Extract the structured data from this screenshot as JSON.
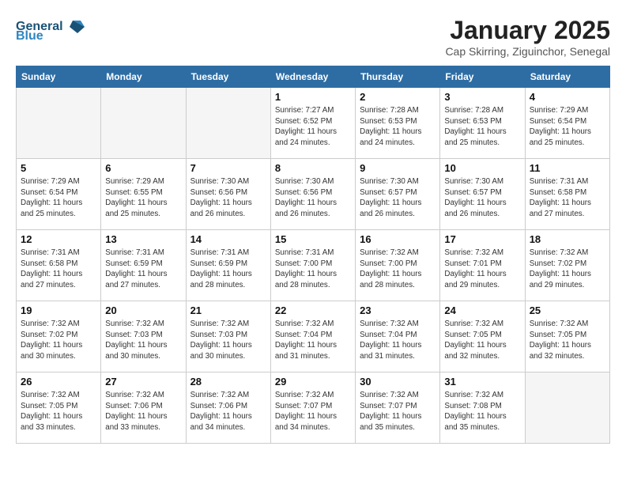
{
  "header": {
    "logo_line1": "General",
    "logo_line2": "Blue",
    "month": "January 2025",
    "location": "Cap Skirring, Ziguinchor, Senegal"
  },
  "days_of_week": [
    "Sunday",
    "Monday",
    "Tuesday",
    "Wednesday",
    "Thursday",
    "Friday",
    "Saturday"
  ],
  "weeks": [
    [
      {
        "day": "",
        "info": ""
      },
      {
        "day": "",
        "info": ""
      },
      {
        "day": "",
        "info": ""
      },
      {
        "day": "1",
        "info": "Sunrise: 7:27 AM\nSunset: 6:52 PM\nDaylight: 11 hours and 24 minutes."
      },
      {
        "day": "2",
        "info": "Sunrise: 7:28 AM\nSunset: 6:53 PM\nDaylight: 11 hours and 24 minutes."
      },
      {
        "day": "3",
        "info": "Sunrise: 7:28 AM\nSunset: 6:53 PM\nDaylight: 11 hours and 25 minutes."
      },
      {
        "day": "4",
        "info": "Sunrise: 7:29 AM\nSunset: 6:54 PM\nDaylight: 11 hours and 25 minutes."
      }
    ],
    [
      {
        "day": "5",
        "info": "Sunrise: 7:29 AM\nSunset: 6:54 PM\nDaylight: 11 hours and 25 minutes."
      },
      {
        "day": "6",
        "info": "Sunrise: 7:29 AM\nSunset: 6:55 PM\nDaylight: 11 hours and 25 minutes."
      },
      {
        "day": "7",
        "info": "Sunrise: 7:30 AM\nSunset: 6:56 PM\nDaylight: 11 hours and 26 minutes."
      },
      {
        "day": "8",
        "info": "Sunrise: 7:30 AM\nSunset: 6:56 PM\nDaylight: 11 hours and 26 minutes."
      },
      {
        "day": "9",
        "info": "Sunrise: 7:30 AM\nSunset: 6:57 PM\nDaylight: 11 hours and 26 minutes."
      },
      {
        "day": "10",
        "info": "Sunrise: 7:30 AM\nSunset: 6:57 PM\nDaylight: 11 hours and 26 minutes."
      },
      {
        "day": "11",
        "info": "Sunrise: 7:31 AM\nSunset: 6:58 PM\nDaylight: 11 hours and 27 minutes."
      }
    ],
    [
      {
        "day": "12",
        "info": "Sunrise: 7:31 AM\nSunset: 6:58 PM\nDaylight: 11 hours and 27 minutes."
      },
      {
        "day": "13",
        "info": "Sunrise: 7:31 AM\nSunset: 6:59 PM\nDaylight: 11 hours and 27 minutes."
      },
      {
        "day": "14",
        "info": "Sunrise: 7:31 AM\nSunset: 6:59 PM\nDaylight: 11 hours and 28 minutes."
      },
      {
        "day": "15",
        "info": "Sunrise: 7:31 AM\nSunset: 7:00 PM\nDaylight: 11 hours and 28 minutes."
      },
      {
        "day": "16",
        "info": "Sunrise: 7:32 AM\nSunset: 7:00 PM\nDaylight: 11 hours and 28 minutes."
      },
      {
        "day": "17",
        "info": "Sunrise: 7:32 AM\nSunset: 7:01 PM\nDaylight: 11 hours and 29 minutes."
      },
      {
        "day": "18",
        "info": "Sunrise: 7:32 AM\nSunset: 7:02 PM\nDaylight: 11 hours and 29 minutes."
      }
    ],
    [
      {
        "day": "19",
        "info": "Sunrise: 7:32 AM\nSunset: 7:02 PM\nDaylight: 11 hours and 30 minutes."
      },
      {
        "day": "20",
        "info": "Sunrise: 7:32 AM\nSunset: 7:03 PM\nDaylight: 11 hours and 30 minutes."
      },
      {
        "day": "21",
        "info": "Sunrise: 7:32 AM\nSunset: 7:03 PM\nDaylight: 11 hours and 30 minutes."
      },
      {
        "day": "22",
        "info": "Sunrise: 7:32 AM\nSunset: 7:04 PM\nDaylight: 11 hours and 31 minutes."
      },
      {
        "day": "23",
        "info": "Sunrise: 7:32 AM\nSunset: 7:04 PM\nDaylight: 11 hours and 31 minutes."
      },
      {
        "day": "24",
        "info": "Sunrise: 7:32 AM\nSunset: 7:05 PM\nDaylight: 11 hours and 32 minutes."
      },
      {
        "day": "25",
        "info": "Sunrise: 7:32 AM\nSunset: 7:05 PM\nDaylight: 11 hours and 32 minutes."
      }
    ],
    [
      {
        "day": "26",
        "info": "Sunrise: 7:32 AM\nSunset: 7:05 PM\nDaylight: 11 hours and 33 minutes."
      },
      {
        "day": "27",
        "info": "Sunrise: 7:32 AM\nSunset: 7:06 PM\nDaylight: 11 hours and 33 minutes."
      },
      {
        "day": "28",
        "info": "Sunrise: 7:32 AM\nSunset: 7:06 PM\nDaylight: 11 hours and 34 minutes."
      },
      {
        "day": "29",
        "info": "Sunrise: 7:32 AM\nSunset: 7:07 PM\nDaylight: 11 hours and 34 minutes."
      },
      {
        "day": "30",
        "info": "Sunrise: 7:32 AM\nSunset: 7:07 PM\nDaylight: 11 hours and 35 minutes."
      },
      {
        "day": "31",
        "info": "Sunrise: 7:32 AM\nSunset: 7:08 PM\nDaylight: 11 hours and 35 minutes."
      },
      {
        "day": "",
        "info": ""
      }
    ]
  ]
}
